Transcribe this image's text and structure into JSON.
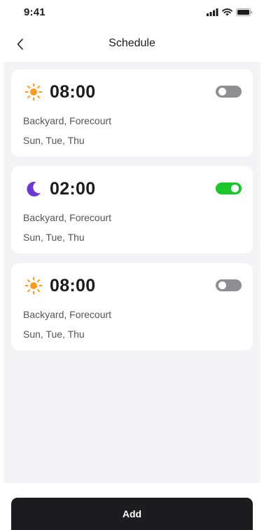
{
  "status_bar": {
    "time": "9:41",
    "icons": [
      "signal-icon",
      "wifi-icon",
      "battery-icon"
    ]
  },
  "header": {
    "back_icon": "chevron-left-icon",
    "title": "Schedule"
  },
  "schedules": [
    {
      "icon": "sun-icon",
      "time": "08:00",
      "enabled": false,
      "locations": "Backyard, Forecourt",
      "days": "Sun, Tue, Thu"
    },
    {
      "icon": "moon-icon",
      "time": "02:00",
      "enabled": true,
      "locations": "Backyard, Forecourt",
      "days": "Sun, Tue, Thu"
    },
    {
      "icon": "sun-icon",
      "time": "08:00",
      "enabled": false,
      "locations": "Backyard, Forecourt",
      "days": "Sun, Tue, Thu"
    }
  ],
  "footer": {
    "add_label": "Add"
  },
  "colors": {
    "sun": "#ff9a1f",
    "moon": "#6b38d6",
    "toggle_on": "#1bc62a",
    "toggle_off": "#8e8e93",
    "button_bg": "#1c1c1e",
    "content_bg": "#f4f4f6"
  }
}
